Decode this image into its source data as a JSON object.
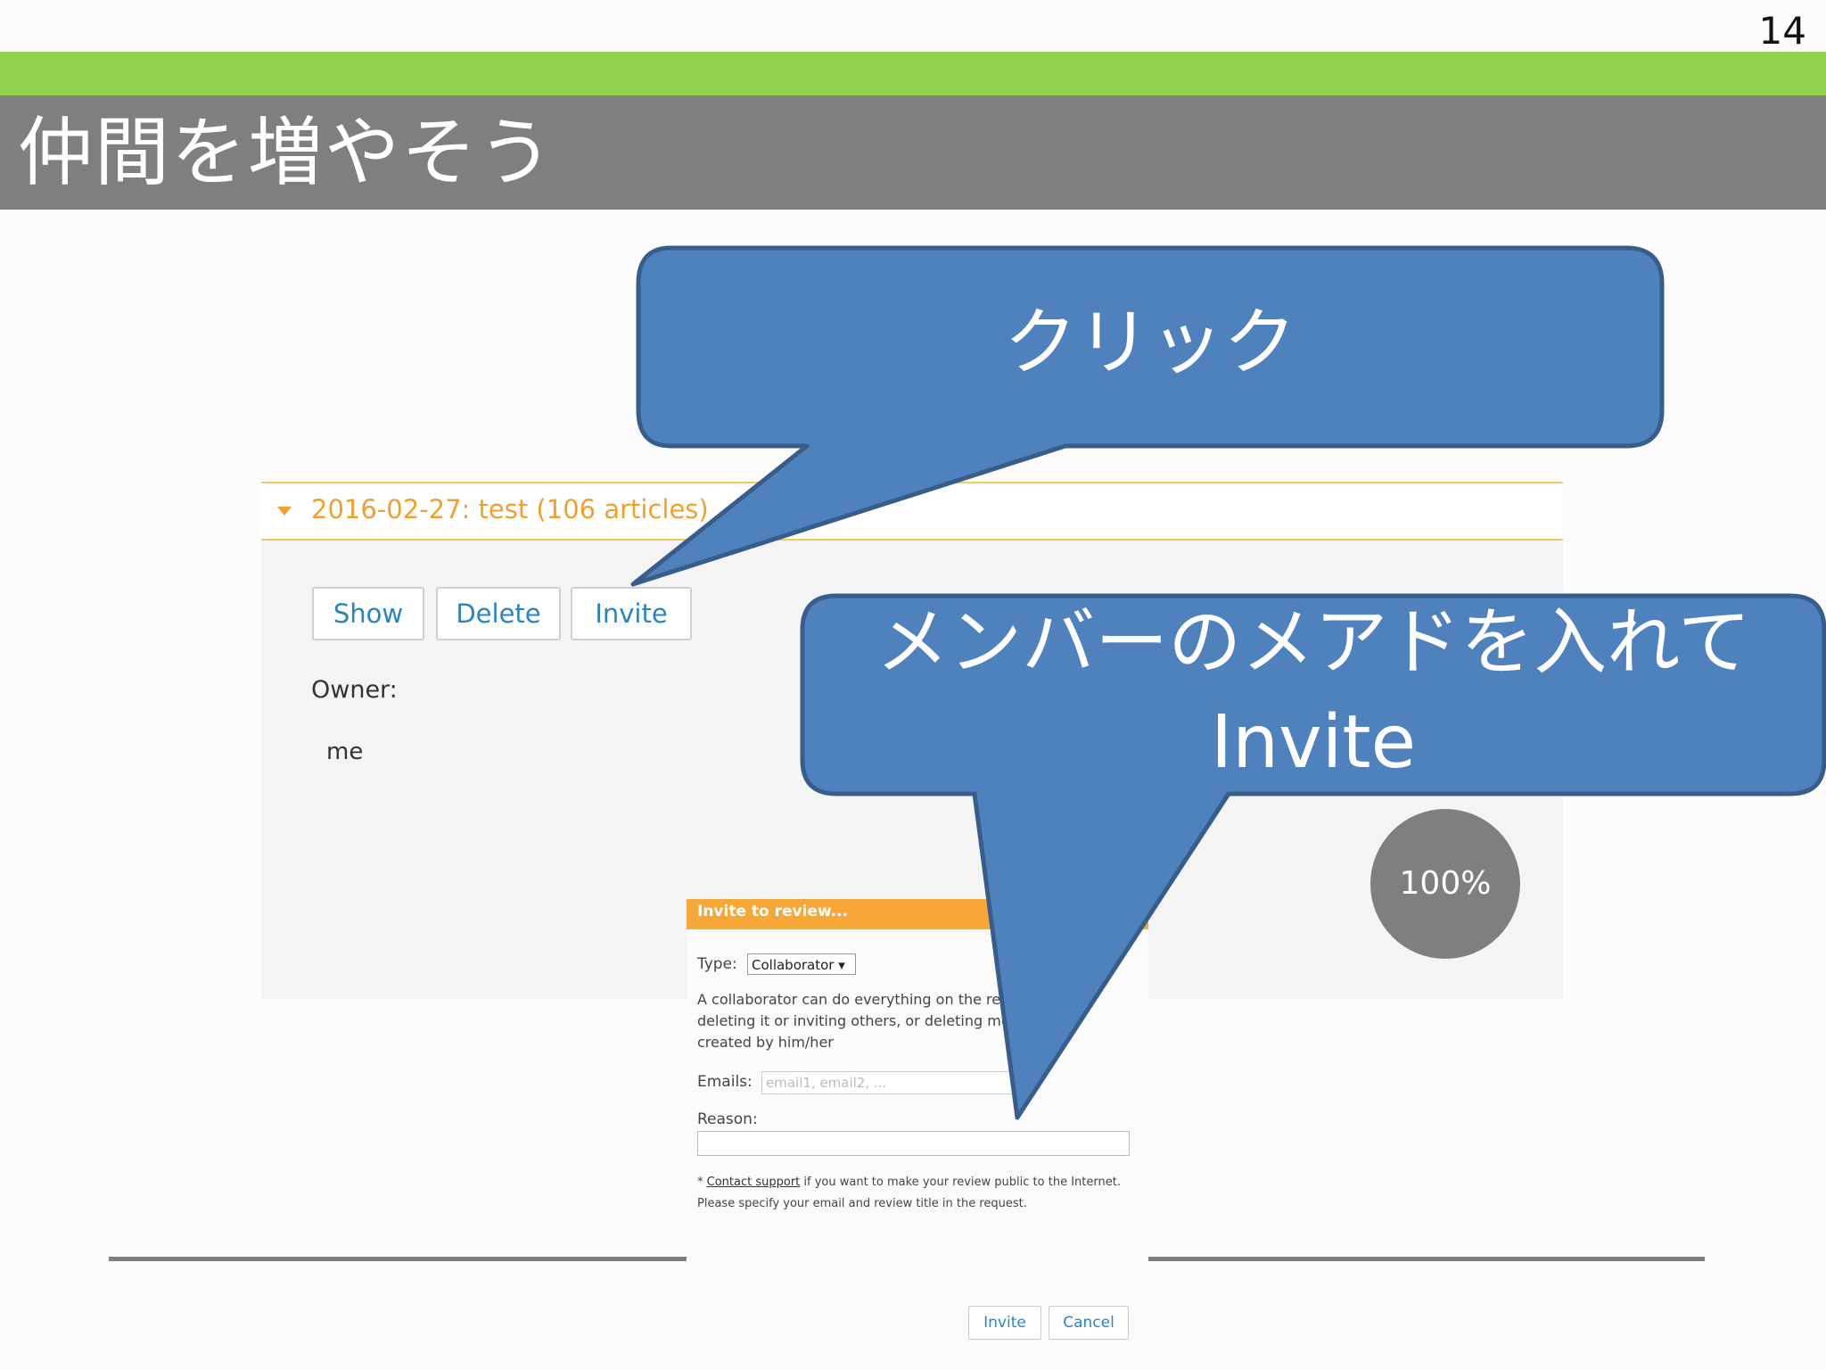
{
  "page": {
    "number": "14",
    "title": "仲間を増やそう"
  },
  "review": {
    "title": "2016-02-27: test (106 articles)",
    "buttons": {
      "show": "Show",
      "delete": "Delete",
      "invite": "Invite"
    },
    "owner_label": "Owner:",
    "owner_value": "me"
  },
  "zoom": "100%",
  "dialog": {
    "title": "Invite to review...",
    "type_label": "Type:",
    "type_value": "Collaborator ▾",
    "description": "A collaborator can do everything on the review except deleting it or inviting others, or deleting methods not created by him/her",
    "emails_label": "Emails:",
    "emails_placeholder": "email1, email2, ...",
    "reason_label": "Reason:",
    "note_prefix": "* ",
    "note_link": "Contact support",
    "note_text": " if you want to make your review public to the Internet. Please specify your email and review title in the request.",
    "invite_button": "Invite",
    "cancel_button": "Cancel"
  },
  "callouts": {
    "click": "クリック",
    "invite_line1": "メンバーのメアドを入れて",
    "invite_line2": "Invite"
  },
  "colors": {
    "accent_green": "#92d050",
    "title_gray": "#7f7f80",
    "callout_blue": "#4f81bd",
    "callout_border": "#385d8a",
    "orange": "#f0a030"
  }
}
